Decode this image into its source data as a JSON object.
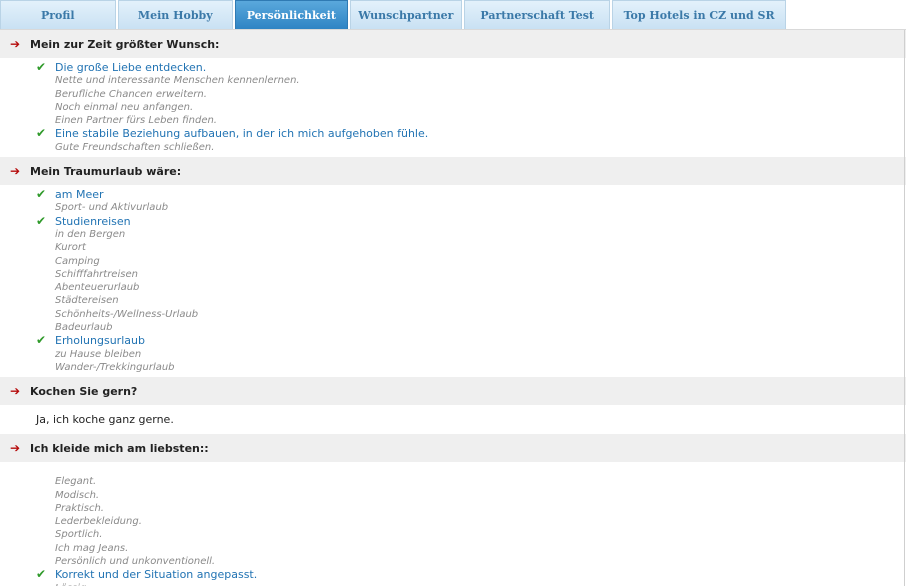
{
  "tabs": [
    {
      "label": "Profil",
      "width": 117,
      "active": false
    },
    {
      "label": "Mein Hobby",
      "width": 117,
      "active": false
    },
    {
      "label": "Persönlichkeit",
      "width": 114,
      "active": true
    },
    {
      "label": "Wunschpartner",
      "width": 114,
      "active": false
    },
    {
      "label": "Partnerschaft Test",
      "width": 148,
      "active": false
    },
    {
      "label": "Top Hotels in CZ und SR",
      "width": 176,
      "active": false
    }
  ],
  "sections": [
    {
      "title": "Mein zur Zeit größter Wunsch:",
      "items": [
        {
          "text": "Die große Liebe entdecken.",
          "selected": true
        },
        {
          "text": "Nette und interessante Menschen kennenlernen.",
          "selected": false
        },
        {
          "text": "Berufliche Chancen erweitern.",
          "selected": false
        },
        {
          "text": "Noch einmal neu anfangen.",
          "selected": false
        },
        {
          "text": "Einen Partner fürs Leben finden.",
          "selected": false
        },
        {
          "text": "Eine stabile Beziehung aufbauen, in der ich mich aufgehoben fühle.",
          "selected": true
        },
        {
          "text": "Gute Freundschaften schließen.",
          "selected": false
        }
      ]
    },
    {
      "title": "Mein Traumurlaub wäre:",
      "items": [
        {
          "text": "am Meer",
          "selected": true
        },
        {
          "text": "Sport- und Aktivurlaub",
          "selected": false
        },
        {
          "text": "Studienreisen",
          "selected": true
        },
        {
          "text": "in den Bergen",
          "selected": false
        },
        {
          "text": "Kurort",
          "selected": false
        },
        {
          "text": "Camping",
          "selected": false
        },
        {
          "text": "Schifffahrtreisen",
          "selected": false
        },
        {
          "text": "Abenteuerurlaub",
          "selected": false
        },
        {
          "text": "Städtereisen",
          "selected": false
        },
        {
          "text": "Schönheits-/Wellness-Urlaub",
          "selected": false
        },
        {
          "text": "Badeurlaub",
          "selected": false
        },
        {
          "text": "Erholungsurlaub",
          "selected": true
        },
        {
          "text": "zu Hause bleiben",
          "selected": false
        },
        {
          "text": "Wander-/Trekkingurlaub",
          "selected": false
        }
      ]
    },
    {
      "title": "Kochen Sie gern?",
      "answer": "Ja, ich koche ganz gerne."
    },
    {
      "title": "Ich kleide mich am liebsten::",
      "items": [
        {
          "text": "Elegant.",
          "selected": false
        },
        {
          "text": "Modisch.",
          "selected": false
        },
        {
          "text": "Praktisch.",
          "selected": false
        },
        {
          "text": "Lederbekleidung.",
          "selected": false
        },
        {
          "text": "Sportlich.",
          "selected": false
        },
        {
          "text": "Ich mag Jeans.",
          "selected": false
        },
        {
          "text": "Persönlich und unkonventionell.",
          "selected": false
        },
        {
          "text": "Korrekt und der Situation angepasst.",
          "selected": true
        },
        {
          "text": "Lässig.",
          "selected": false
        }
      ]
    }
  ],
  "icons": {
    "section_arrow": "arrow-right-icon",
    "selected_mark": "check-icon"
  },
  "colors": {
    "tab_active": "#2f84c4",
    "tab_inactive": "#d6eaf8",
    "selected_text": "#2173b3",
    "unselected_text": "#8a8a8a",
    "check": "#2f9a2a",
    "arrow": "#b50b0b"
  }
}
